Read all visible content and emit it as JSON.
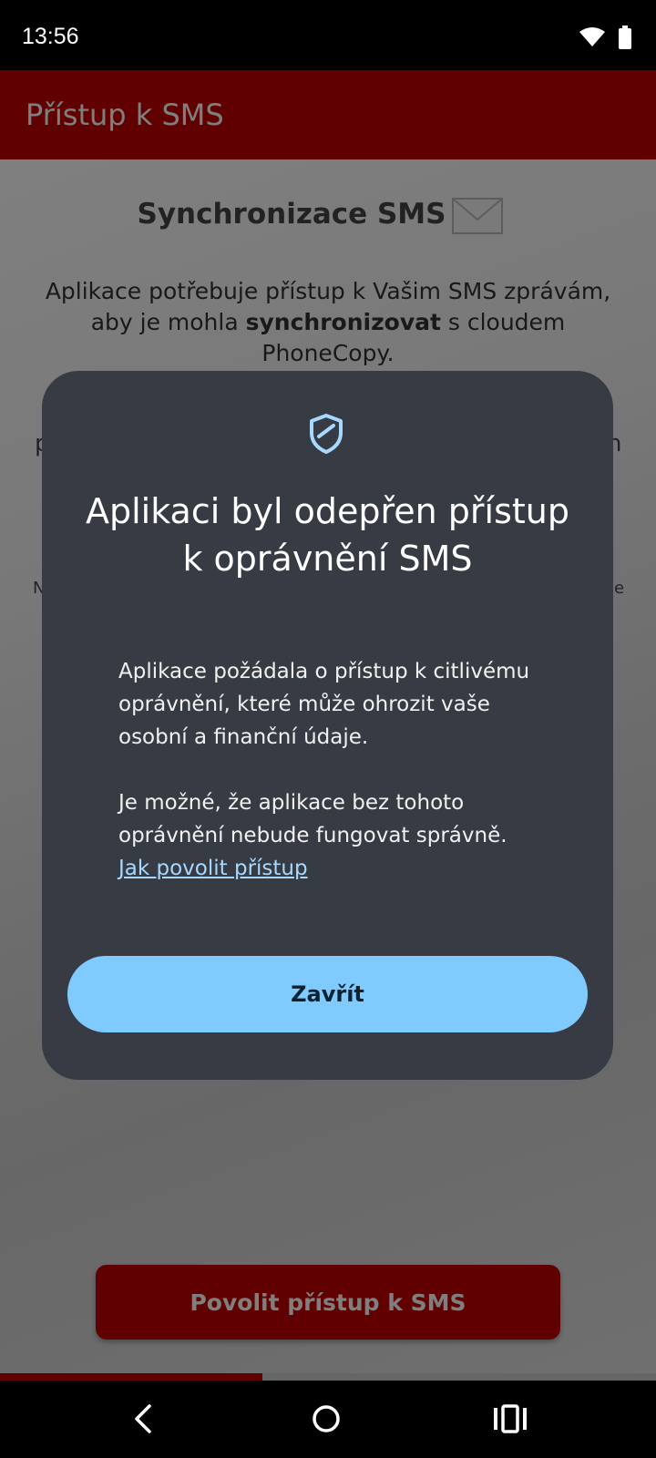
{
  "status_bar": {
    "time": "13:56",
    "icons": [
      "wifi-icon",
      "battery-icon"
    ]
  },
  "app_bar": {
    "title": "Přístup k SMS",
    "color": "#c00000"
  },
  "content": {
    "heading": "Synchronizace SMS",
    "heading_icon": "envelope-icon",
    "desc_part1": "Aplikace potřebuje přístup k Vašim SMS zprávám, aby je mohla ",
    "desc_bold": "synchronizovat",
    "desc_part2": " s cloudem PhoneCopy.",
    "fragment_left": "p",
    "fragment_right": "n",
    "fragment_left2": "N",
    "fragment_right2": "e",
    "allow_button": "Povolit přístup k SMS",
    "progress_fraction": 0.4
  },
  "dialog": {
    "icon": "shield-icon",
    "title": "Aplikaci byl odepřen přístup k oprávnění SMS",
    "body_p1": "Aplikace požádala o přístup k citlivému oprávnění, které může ohrozit vaše osobní a finanční údaje.",
    "body_p2": "Je možné, že aplikace bez tohoto oprávnění nebude fungovat správně.",
    "link": "Jak povolit přístup",
    "close_button": "Zavřít",
    "accent": "#7fcbff"
  },
  "nav_bar": {
    "icons": [
      "back-icon",
      "home-icon",
      "recents-icon"
    ]
  }
}
